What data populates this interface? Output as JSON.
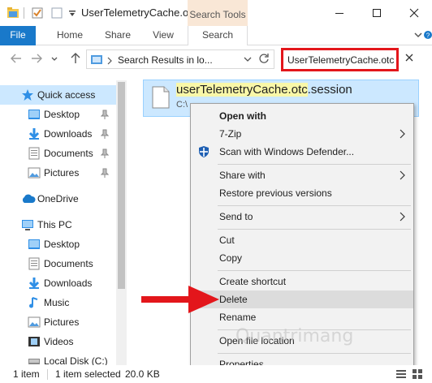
{
  "window": {
    "title": "UserTelemetryCache.otc",
    "contextual_tab": "Search Tools",
    "minimize_icon": "minimize-icon",
    "maximize_icon": "maximize-icon",
    "close_icon": "close-icon"
  },
  "ribbon": {
    "tabs": [
      "File",
      "Home",
      "Share",
      "View",
      "Search"
    ],
    "active_contextual": "Search"
  },
  "address": {
    "path": "Search Results in lo...",
    "search_value": "UserTelemetryCache.otc"
  },
  "nav": {
    "items": [
      {
        "label": "Quick access",
        "icon": "star-icon",
        "pinned": false,
        "selected": true
      },
      {
        "label": "Desktop",
        "icon": "desktop-folder-icon",
        "pinned": true
      },
      {
        "label": "Downloads",
        "icon": "download-arrow-icon",
        "pinned": true
      },
      {
        "label": "Documents",
        "icon": "documents-folder-icon",
        "pinned": true
      },
      {
        "label": "Pictures",
        "icon": "pictures-folder-icon",
        "pinned": true
      },
      {
        "label": "OneDrive",
        "icon": "cloud-icon"
      },
      {
        "label": "This PC",
        "icon": "computer-icon"
      },
      {
        "label": "Desktop",
        "icon": "desktop-folder-icon"
      },
      {
        "label": "Documents",
        "icon": "documents-folder-icon"
      },
      {
        "label": "Downloads",
        "icon": "download-arrow-icon"
      },
      {
        "label": "Music",
        "icon": "music-note-icon"
      },
      {
        "label": "Pictures",
        "icon": "pictures-folder-icon"
      },
      {
        "label": "Videos",
        "icon": "video-folder-icon"
      },
      {
        "label": "Local Disk (C:)",
        "icon": "disk-icon"
      }
    ]
  },
  "file": {
    "name_highlight": "userTelemetryCache.otc",
    "name_rest": ".session",
    "path_prefix": "C:\\"
  },
  "context_menu": {
    "items": [
      {
        "label": "Open with",
        "bold": true
      },
      {
        "label": "7-Zip",
        "submenu": true
      },
      {
        "label": "Scan with Windows Defender...",
        "icon": "windows-defender-icon"
      },
      {
        "label": "Share with",
        "submenu": true
      },
      {
        "label": "Restore previous versions"
      },
      {
        "label": "Send to",
        "submenu": true
      },
      {
        "label": "Cut"
      },
      {
        "label": "Copy"
      },
      {
        "label": "Create shortcut"
      },
      {
        "label": "Delete",
        "highlighted": true
      },
      {
        "label": "Rename"
      },
      {
        "label": "Open file location"
      },
      {
        "label": "Properties"
      }
    ]
  },
  "status": {
    "count": "1 item",
    "selected": "1 item selected",
    "size": "20.0 KB"
  },
  "watermark": "Quantrimang",
  "colors": {
    "file_tab": "#1979ca",
    "search_tools_tab": "#f9e7d6",
    "selection": "#cce8ff",
    "highlight_box": "#e3161b",
    "arrow": "#e3161b"
  }
}
